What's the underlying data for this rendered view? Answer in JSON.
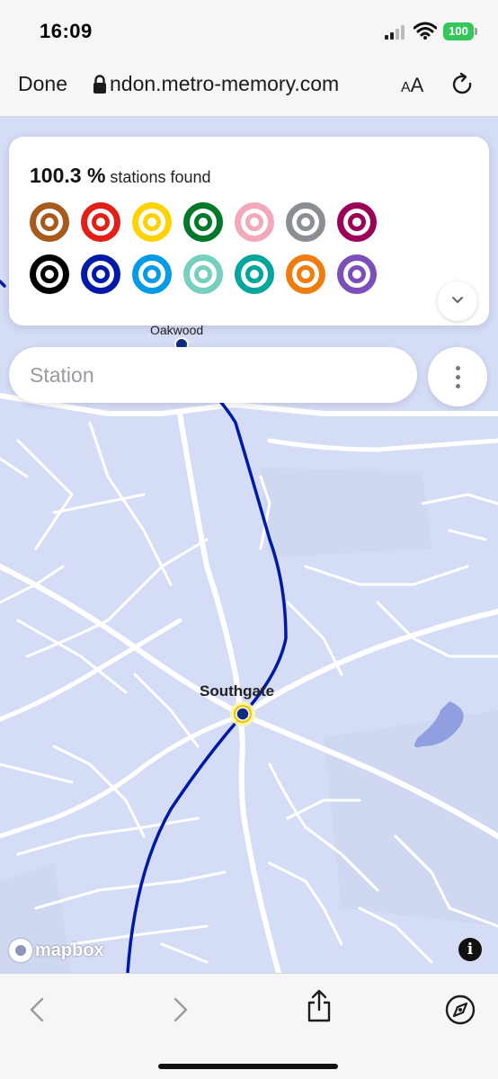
{
  "status_bar": {
    "time": "16:09",
    "battery": "100"
  },
  "browser": {
    "done_label": "Done",
    "url": "ndon.metro-memory.com",
    "aa_small": "A",
    "aa_big": "A"
  },
  "stats": {
    "percent": "100.3 %",
    "label": "stations found",
    "lines": [
      {
        "name": "bakerloo",
        "color": "#a65a1e"
      },
      {
        "name": "central",
        "color": "#e32017"
      },
      {
        "name": "circle",
        "color": "#ffd300"
      },
      {
        "name": "district",
        "color": "#00782a"
      },
      {
        "name": "hammersmith-city",
        "color": "#f3a9bb"
      },
      {
        "name": "jubilee",
        "color": "#8b8f93"
      },
      {
        "name": "metropolitan",
        "color": "#9b0056"
      },
      {
        "name": "northern",
        "color": "#000000"
      },
      {
        "name": "piccadilly",
        "color": "#0019a8"
      },
      {
        "name": "victoria",
        "color": "#039be5"
      },
      {
        "name": "waterloo-city",
        "color": "#76d0bd"
      },
      {
        "name": "elizabeth-teal",
        "color": "#00a69c"
      },
      {
        "name": "overground",
        "color": "#ee7c0e"
      },
      {
        "name": "elizabeth",
        "color": "#7b4fb8"
      }
    ]
  },
  "search": {
    "placeholder": "Station"
  },
  "map": {
    "stations": {
      "oakwood": "Oakwood",
      "southgate": "Southgate"
    },
    "attribution": "mapbox",
    "info": "i",
    "line_color": "#0019a8",
    "road_color": "#ffffff",
    "land_color": "#d5dcf6"
  },
  "icons": {
    "back": "chevron-left-icon",
    "forward": "chevron-right-icon",
    "share": "share-icon",
    "safari": "compass-icon"
  }
}
